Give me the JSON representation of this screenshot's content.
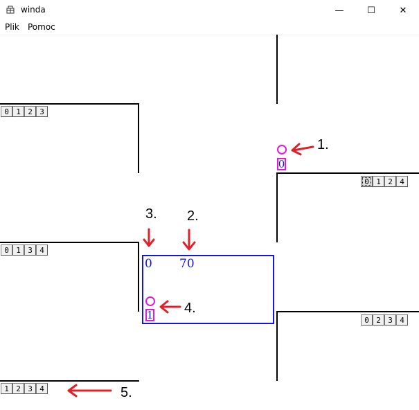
{
  "window": {
    "title": "winda",
    "minimize_glyph": "—",
    "maximize_glyph": "☐",
    "close_glyph": "✕"
  },
  "menu": {
    "items": [
      "Plik",
      "Pomoc"
    ]
  },
  "digit_groups": {
    "left_top": [
      "0",
      "1",
      "2",
      "3"
    ],
    "left_mid": [
      "0",
      "1",
      "3",
      "4"
    ],
    "left_bottom": [
      "1",
      "2",
      "3",
      "4"
    ],
    "right_top": [
      "0",
      "1",
      "2",
      "4"
    ],
    "right_bottom": [
      "0",
      "2",
      "3",
      "4"
    ]
  },
  "center_box": {
    "left_value": "0",
    "right_value": "70",
    "marker_value": "1"
  },
  "right_marker": {
    "value": "0"
  },
  "annotations": {
    "n1": "1.",
    "n2": "2.",
    "n3": "3.",
    "n4": "4.",
    "n5": "5."
  },
  "colors": {
    "arrow": "#e0202a",
    "box": "#1515e0",
    "marker": "#e018e0"
  }
}
